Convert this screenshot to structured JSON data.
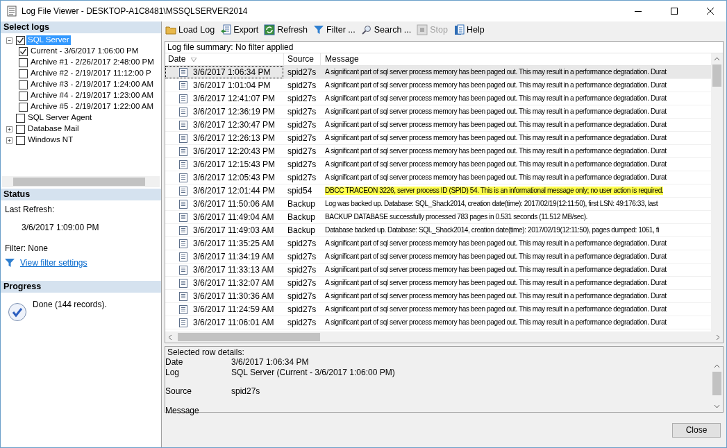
{
  "window": {
    "title": "Log File Viewer - DESKTOP-A1C8481\\MSSQLSERVER2014"
  },
  "select_logs": {
    "title": "Select logs",
    "items": [
      {
        "label": "SQL Server",
        "checked": true,
        "selected": true,
        "expanded": true,
        "children": [
          {
            "label": "Current - 3/6/2017 1:06:00 PM",
            "checked": true,
            "selected": false
          },
          {
            "label": "Archive #1 - 2/26/2017 2:48:00 PM",
            "checked": false,
            "selected": false
          },
          {
            "label": "Archive #2 - 2/19/2017 11:12:00 P",
            "checked": false,
            "selected": false
          },
          {
            "label": "Archive #3 - 2/19/2017 1:24:00 AM",
            "checked": false,
            "selected": false
          },
          {
            "label": "Archive #4 - 2/19/2017 1:23:00 AM",
            "checked": false,
            "selected": false
          },
          {
            "label": "Archive #5 - 2/19/2017 1:22:00 AM",
            "checked": false,
            "selected": false
          }
        ]
      },
      {
        "label": "SQL Server Agent",
        "checked": false,
        "selected": false
      },
      {
        "label": "Database Mail",
        "checked": false,
        "selected": false,
        "expanded": false
      },
      {
        "label": "Windows NT",
        "checked": false,
        "selected": false,
        "expanded": false
      }
    ]
  },
  "status": {
    "title": "Status",
    "last_refresh_label": "Last Refresh:",
    "last_refresh": "3/6/2017 1:09:00 PM",
    "filter": "Filter: None",
    "filter_link": "View filter settings"
  },
  "progress": {
    "title": "Progress",
    "text": "Done (144 records)."
  },
  "toolbar": [
    {
      "label": "Load Log",
      "kind": "folder",
      "disabled": false
    },
    {
      "label": "Export",
      "kind": "export",
      "disabled": false
    },
    {
      "label": "Refresh",
      "kind": "refresh",
      "disabled": false
    },
    {
      "label": "Filter ...",
      "kind": "filter",
      "disabled": false
    },
    {
      "label": "Search ...",
      "kind": "search",
      "disabled": false
    },
    {
      "label": "Stop",
      "kind": "stop",
      "disabled": true
    },
    {
      "label": "Help",
      "kind": "help",
      "disabled": false
    }
  ],
  "summary": "Log file summary: No filter applied",
  "table": {
    "columns": [
      "Date",
      "Source",
      "Message"
    ],
    "rows": [
      {
        "date": "3/6/2017 1:06:34 PM",
        "source": "spid27s",
        "message": "A significant part of sql server process memory has been paged out. This may result in a performance degradation. Durat",
        "selected": true,
        "highlighted": false
      },
      {
        "date": "3/6/2017 1:01:04 PM",
        "source": "spid27s",
        "message": "A significant part of sql server process memory has been paged out. This may result in a performance degradation. Durat",
        "selected": false,
        "highlighted": false
      },
      {
        "date": "3/6/2017 12:41:07 PM",
        "source": "spid27s",
        "message": "A significant part of sql server process memory has been paged out. This may result in a performance degradation. Durat",
        "selected": false,
        "highlighted": false
      },
      {
        "date": "3/6/2017 12:36:19 PM",
        "source": "spid27s",
        "message": "A significant part of sql server process memory has been paged out. This may result in a performance degradation. Durat",
        "selected": false,
        "highlighted": false
      },
      {
        "date": "3/6/2017 12:30:47 PM",
        "source": "spid27s",
        "message": "A significant part of sql server process memory has been paged out. This may result in a performance degradation. Durat",
        "selected": false,
        "highlighted": false
      },
      {
        "date": "3/6/2017 12:26:13 PM",
        "source": "spid27s",
        "message": "A significant part of sql server process memory has been paged out. This may result in a performance degradation. Durat",
        "selected": false,
        "highlighted": false
      },
      {
        "date": "3/6/2017 12:20:43 PM",
        "source": "spid27s",
        "message": "A significant part of sql server process memory has been paged out. This may result in a performance degradation. Durat",
        "selected": false,
        "highlighted": false
      },
      {
        "date": "3/6/2017 12:15:43 PM",
        "source": "spid27s",
        "message": "A significant part of sql server process memory has been paged out. This may result in a performance degradation. Durat",
        "selected": false,
        "highlighted": false
      },
      {
        "date": "3/6/2017 12:05:43 PM",
        "source": "spid27s",
        "message": "A significant part of sql server process memory has been paged out. This may result in a performance degradation. Durat",
        "selected": false,
        "highlighted": false
      },
      {
        "date": "3/6/2017 12:01:44 PM",
        "source": "spid54",
        "message": "DBCC TRACEON 3226, server process ID (SPID) 54. This is an informational message only; no user action is required.",
        "selected": false,
        "highlighted": true
      },
      {
        "date": "3/6/2017 11:50:06 AM",
        "source": "Backup",
        "message": "Log was backed up. Database: SQL_Shack2014, creation date(time): 2017/02/19(12:11:50), first LSN: 49:176:33, last",
        "selected": false,
        "highlighted": false
      },
      {
        "date": "3/6/2017 11:49:04 AM",
        "source": "Backup",
        "message": "BACKUP DATABASE successfully processed 783 pages in 0.531 seconds (11.512 MB/sec).",
        "selected": false,
        "highlighted": false
      },
      {
        "date": "3/6/2017 11:49:03 AM",
        "source": "Backup",
        "message": "Database backed up. Database: SQL_Shack2014, creation date(time): 2017/02/19(12:11:50), pages dumped: 1061, fi",
        "selected": false,
        "highlighted": false
      },
      {
        "date": "3/6/2017 11:35:25 AM",
        "source": "spid27s",
        "message": "A significant part of sql server process memory has been paged out. This may result in a performance degradation. Durat",
        "selected": false,
        "highlighted": false
      },
      {
        "date": "3/6/2017 11:34:19 AM",
        "source": "spid27s",
        "message": "A significant part of sql server process memory has been paged out. This may result in a performance degradation. Durat",
        "selected": false,
        "highlighted": false
      },
      {
        "date": "3/6/2017 11:33:13 AM",
        "source": "spid27s",
        "message": "A significant part of sql server process memory has been paged out. This may result in a performance degradation. Durat",
        "selected": false,
        "highlighted": false
      },
      {
        "date": "3/6/2017 11:32:07 AM",
        "source": "spid27s",
        "message": "A significant part of sql server process memory has been paged out. This may result in a performance degradation. Durat",
        "selected": false,
        "highlighted": false
      },
      {
        "date": "3/6/2017 11:30:36 AM",
        "source": "spid27s",
        "message": "A significant part of sql server process memory has been paged out. This may result in a performance degradation. Durat",
        "selected": false,
        "highlighted": false
      },
      {
        "date": "3/6/2017 11:24:59 AM",
        "source": "spid27s",
        "message": "A significant part of sql server process memory has been paged out. This may result in a performance degradation. Durat",
        "selected": false,
        "highlighted": false
      },
      {
        "date": "3/6/2017 11:06:01 AM",
        "source": "spid27s",
        "message": "A significant part of sql server process memory has been paged out. This may result in a performance degradation. Durat",
        "selected": false,
        "highlighted": false
      }
    ]
  },
  "details": {
    "title": "Selected row details:",
    "fields": [
      {
        "label": "Date",
        "value": "3/6/2017 1:06:34 PM"
      },
      {
        "label": "Log",
        "value": "SQL Server (Current - 3/6/2017 1:06:00 PM)"
      },
      {
        "label": "Source",
        "value": "spid27s"
      },
      {
        "label": "Message"
      }
    ]
  },
  "buttons": [
    "Close"
  ]
}
